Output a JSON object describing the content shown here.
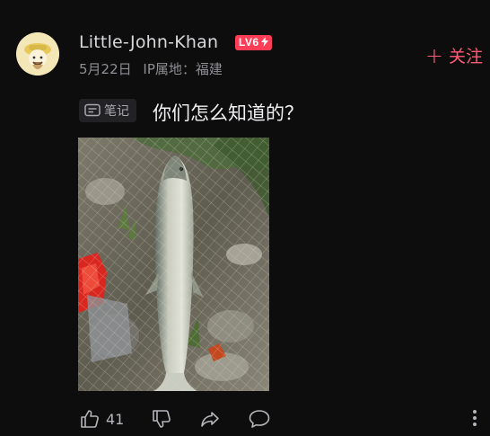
{
  "author": {
    "name": "Little-John-Khan",
    "level_badge": "LV6",
    "date": "5月22日",
    "ip_location": "IP属地：福建"
  },
  "follow": {
    "label": "关注"
  },
  "post": {
    "tag": "笔记",
    "title": "你们怎么知道的？"
  },
  "actions": {
    "like_count": "41"
  },
  "colors": {
    "accent": "#ff5c74",
    "badge": "#ff3d57",
    "background": "#0d0d0e"
  }
}
